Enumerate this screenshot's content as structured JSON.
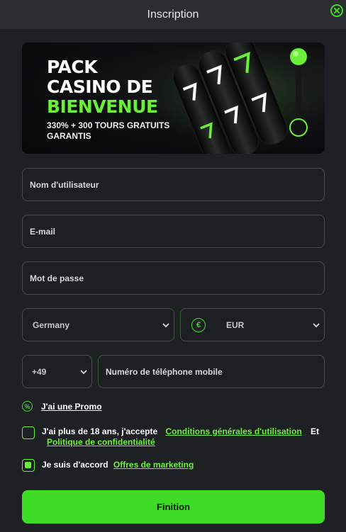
{
  "header": {
    "title": "Inscription",
    "close_icon": "close-circle-icon"
  },
  "banner": {
    "line1": "PACK",
    "line2": "CASINO DE",
    "line3": "BIENVENUE",
    "subtitle": "330% + 300 TOURS GRATUITS GARANTIS",
    "art_icon": "slot-machine-reels-icon"
  },
  "form": {
    "username_placeholder": "Nom d'utilisateur",
    "email_placeholder": "E-mail",
    "password_placeholder": "Mot de passe",
    "country_value": "Germany",
    "currency_symbol": "€",
    "currency_value": "EUR",
    "phone_code": "+49",
    "phone_placeholder": "Numéro de téléphone mobile"
  },
  "promo": {
    "label": "J'ai une Promo",
    "icon": "percent-icon"
  },
  "terms": {
    "prefix": "J'ai plus de 18 ans, j'accepte",
    "link1": "Conditions générales d'utilisation",
    "conjunction": "Et",
    "link2": "Politique de confidentialité",
    "checked": false
  },
  "marketing": {
    "prefix": "Je suis d'accord",
    "link": "Offres de marketing",
    "checked": true
  },
  "submit_label": "Finition",
  "colors": {
    "accent": "#3fdc25",
    "accent_light": "#6bf03a",
    "border": "#2f5a2e",
    "background": "#1f2024"
  }
}
